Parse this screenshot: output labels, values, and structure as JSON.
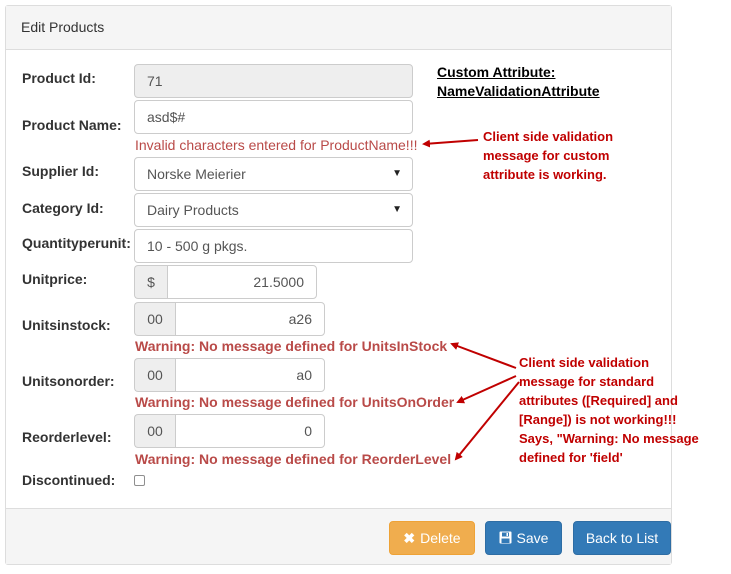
{
  "panel": {
    "heading": "Edit Products"
  },
  "fields": {
    "product_id": {
      "label": "Product Id:",
      "value": "71"
    },
    "product_name": {
      "label": "Product Name:",
      "value": "asd$#",
      "error": "Invalid characters entered for ProductName!!!"
    },
    "supplier_id": {
      "label": "Supplier Id:",
      "selected": "Norske Meierier"
    },
    "category_id": {
      "label": "Category Id:",
      "selected": "Dairy Products"
    },
    "quantity_per_unit": {
      "label": "Quantityperunit:",
      "value": "10 - 500 g pkgs."
    },
    "unit_price": {
      "label": "Unitprice:",
      "addon": "$",
      "value": "21.5000"
    },
    "units_in_stock": {
      "label": "Unitsinstock:",
      "addon": "00",
      "value": "a26",
      "error": "Warning: No message defined for UnitsInStock"
    },
    "units_on_order": {
      "label": "Unitsonorder:",
      "addon": "00",
      "value": "a0",
      "error": "Warning: No message defined for UnitsOnOrder"
    },
    "reorder_level": {
      "label": "Reorderlevel:",
      "addon": "00",
      "value": "0",
      "error": "Warning: No message defined for ReorderLevel"
    },
    "discontinued": {
      "label": "Discontinued:"
    }
  },
  "footer": {
    "delete_label": "Delete",
    "save_label": "Save",
    "back_label": "Back to List"
  },
  "annotations": {
    "custom_attr_line1": "Custom Attribute:",
    "custom_attr_line2": "NameValidationAttribute",
    "note1_line1": "Client side validation",
    "note1_line2": "message for custom",
    "note1_line3": "attribute is working.",
    "note2_line1": "Client side validation",
    "note2_line2": "message for standard",
    "note2_line3": "attributes ([Required] and",
    "note2_line4": "[Range]) is not working!!!",
    "note2_line5": "Says, \"Warning: No message",
    "note2_line6": "defined for 'field'"
  },
  "colors": {
    "error": "#b94a48",
    "annotation": "#c00000",
    "warning_button": "#f0ad4e",
    "primary_button": "#337ab7"
  },
  "icons": {
    "delete": "times-icon",
    "save": "floppy-disk-icon",
    "select": "caret-down-icon"
  }
}
